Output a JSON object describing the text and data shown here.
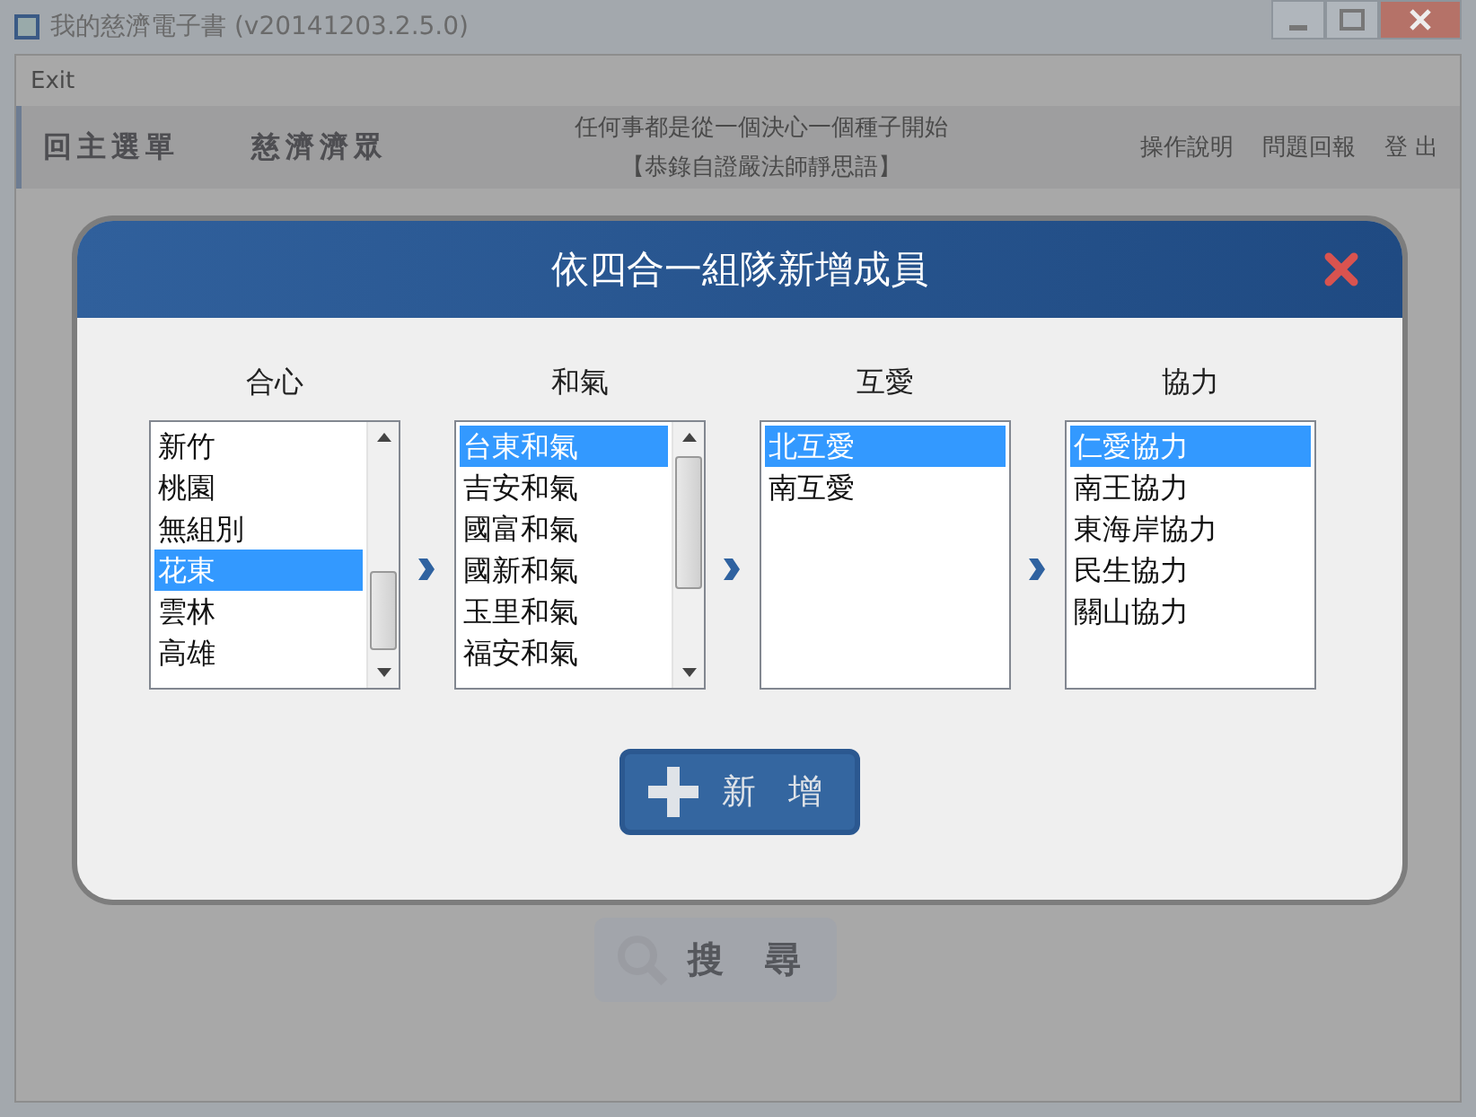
{
  "window": {
    "title": "我的慈濟電子書 (v20141203.2.5.0)"
  },
  "menu": [
    "Exit"
  ],
  "header": {
    "nav": [
      "回主選單",
      "慈濟濟眾"
    ],
    "motto": "任何事都是從一個決心一個種子開始",
    "source": "【恭錄自證嚴法師靜思語】",
    "links": [
      "操作說明",
      "問題回報",
      "登 出"
    ]
  },
  "dialog": {
    "title": "依四合一組隊新增成員",
    "columns": [
      {
        "heading": "合心",
        "scrollable": true,
        "items": [
          {
            "label": "新竹",
            "selected": false
          },
          {
            "label": "桃園",
            "selected": false
          },
          {
            "label": "無組別",
            "selected": false
          },
          {
            "label": "花東",
            "selected": true
          },
          {
            "label": "雲林",
            "selected": false
          },
          {
            "label": "高雄",
            "selected": false
          }
        ]
      },
      {
        "heading": "和氣",
        "scrollable": true,
        "items": [
          {
            "label": "台東和氣",
            "selected": true
          },
          {
            "label": "吉安和氣",
            "selected": false
          },
          {
            "label": "國富和氣",
            "selected": false
          },
          {
            "label": "國新和氣",
            "selected": false
          },
          {
            "label": "玉里和氣",
            "selected": false
          },
          {
            "label": "福安和氣",
            "selected": false
          }
        ]
      },
      {
        "heading": "互愛",
        "scrollable": false,
        "items": [
          {
            "label": "北互愛",
            "selected": true
          },
          {
            "label": "南互愛",
            "selected": false
          }
        ]
      },
      {
        "heading": "協力",
        "scrollable": false,
        "items": [
          {
            "label": "仁愛協力",
            "selected": true
          },
          {
            "label": "南王協力",
            "selected": false
          },
          {
            "label": "東海岸協力",
            "selected": false
          },
          {
            "label": "民生協力",
            "selected": false
          },
          {
            "label": "關山協力",
            "selected": false
          }
        ]
      }
    ],
    "add_button": "新 增"
  },
  "search_button": "搜 尋"
}
